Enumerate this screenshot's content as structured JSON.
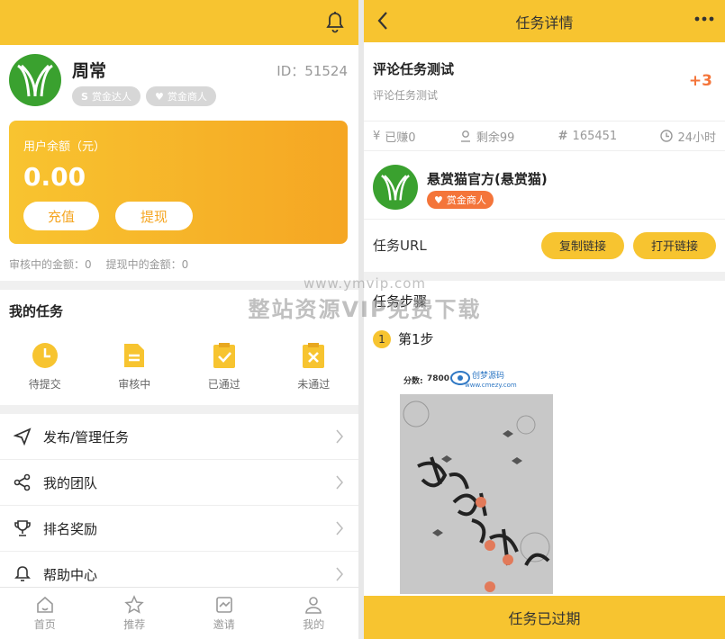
{
  "left": {
    "user": {
      "name": "周常",
      "id": "ID：51524"
    },
    "badges": [
      {
        "icon": "s-icon",
        "label": "赏金达人"
      },
      {
        "icon": "heart-icon",
        "label": "赏金商人"
      }
    ],
    "balance": {
      "label": "用户余额（元）",
      "value": "0.00",
      "recharge": "充值",
      "withdraw": "提现"
    },
    "pending": {
      "review": "审核中的金额：0",
      "withdraw": "提现中的金额：0"
    },
    "my_tasks": {
      "title": "我的任务",
      "items": [
        {
          "icon": "clock-icon",
          "label": "待提交"
        },
        {
          "icon": "document-icon",
          "label": "审核中"
        },
        {
          "icon": "check-clipboard-icon",
          "label": "已通过"
        },
        {
          "icon": "x-clipboard-icon",
          "label": "未通过"
        }
      ]
    },
    "menu": [
      {
        "icon": "send-icon",
        "label": "发布/管理任务"
      },
      {
        "icon": "share-icon",
        "label": "我的团队"
      },
      {
        "icon": "trophy-icon",
        "label": "排名奖励"
      },
      {
        "icon": "bell-icon",
        "label": "帮助中心"
      }
    ],
    "tabs": [
      {
        "icon": "home-icon",
        "label": "首页"
      },
      {
        "icon": "star-icon",
        "label": "推荐"
      },
      {
        "icon": "invite-icon",
        "label": "邀请"
      },
      {
        "icon": "user-icon",
        "label": "我的"
      }
    ]
  },
  "right": {
    "header": {
      "title": "任务详情"
    },
    "task": {
      "title": "评论任务测试",
      "subtitle": "评论任务测试",
      "reward": "+3"
    },
    "stats": [
      {
        "icon": "yen-icon",
        "label": "已赚0"
      },
      {
        "icon": "person-icon",
        "label": "剩余99"
      },
      {
        "icon": "hash-icon",
        "label": "165451"
      },
      {
        "icon": "clock-icon",
        "label": "24小时"
      }
    ],
    "publisher": {
      "name": "悬赏猫官方(悬赏猫)",
      "badge": "赏金商人"
    },
    "url": {
      "label": "任务URL",
      "copy": "复制链接",
      "open": "打开链接"
    },
    "steps": {
      "title": "任务步骤",
      "step1_num": "1",
      "step1_label": "第1步"
    },
    "screenshot": {
      "score_label": "分数:",
      "score": "7800",
      "brand": "创梦源码",
      "site": "www.cmezy.com"
    },
    "footer": "任务已过期"
  },
  "watermark": {
    "url": "www.ymvip.com",
    "text": "整站资源VIP免费下载"
  },
  "colors": {
    "accent": "#f7c430",
    "orange": "#f4753a",
    "green": "#3aa12f"
  }
}
